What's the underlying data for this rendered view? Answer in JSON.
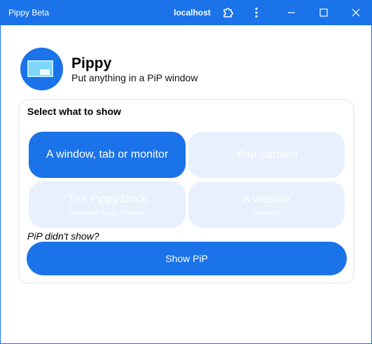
{
  "titlebar": {
    "app_title": "Pippy Beta",
    "host": "localhost",
    "icons": [
      "extension-icon",
      "more-vert-icon",
      "minimize-icon",
      "maximize-icon",
      "close-icon"
    ]
  },
  "header": {
    "name": "Pippy",
    "tagline": "Put anything in a PiP window",
    "icon": "pip-app-icon"
  },
  "panel": {
    "title": "Select what to show",
    "options": [
      {
        "label": "A window, tab or monitor",
        "sublabel": "",
        "selected": true
      },
      {
        "label": "Your camera",
        "sublabel": "",
        "selected": false
      },
      {
        "label": "The Pippy Dock",
        "sublabel": "Searchbar, News, Weather",
        "selected": false
      },
      {
        "label": "A website",
        "sublabel": "Interactive",
        "selected": false
      }
    ],
    "hint": "PiP didn't show?",
    "show_button": "Show PiP"
  },
  "colors": {
    "accent": "#1a73e8",
    "option_inactive": "#e8f0fe",
    "panel_border": "#eef1f5"
  }
}
